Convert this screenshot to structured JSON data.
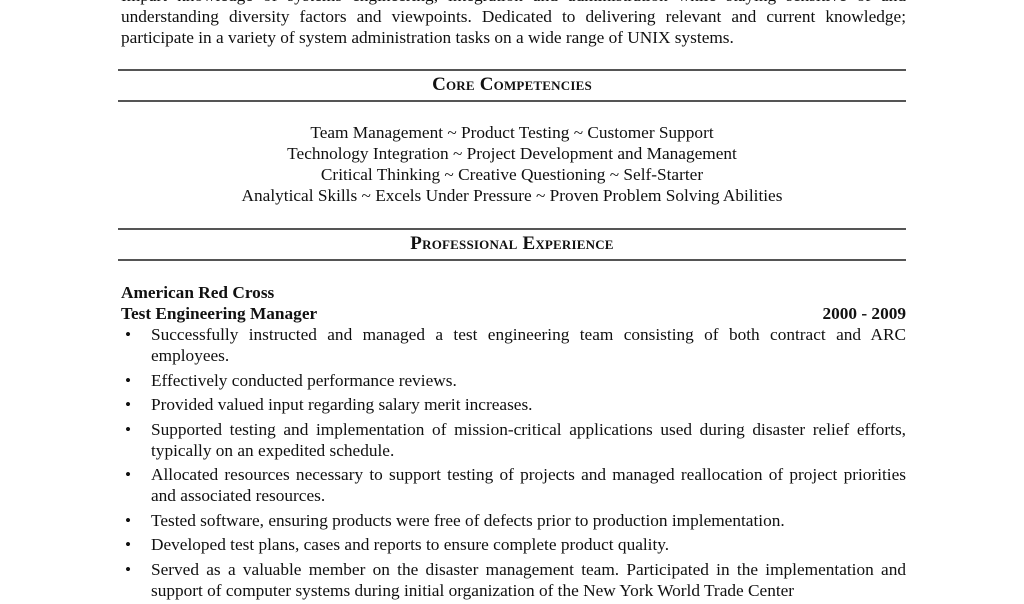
{
  "summary": {
    "lines": [
      "Impart knowledge of systems engineering, integration and administration while staying sensitive of and",
      "understanding diversity factors and viewpoints.  Dedicated to delivering relevant and current knowledge;",
      "participate in a variety of system administration tasks on a wide range of UNIX systems."
    ]
  },
  "sections": {
    "core_competencies": {
      "title": "Core Competencies",
      "rows": [
        "Team Management ~ Product Testing ~ Customer Support",
        "Technology Integration ~ Project Development and Management",
        "Critical Thinking ~ Creative Questioning ~ Self-Starter",
        "Analytical Skills ~ Excels Under Pressure ~ Proven Problem Solving Abilities"
      ]
    },
    "professional_experience": {
      "title": "Professional Experience",
      "jobs": [
        {
          "employer": "American Red Cross",
          "title": "Test Engineering Manager",
          "dates": "2000 - 2009",
          "bullet_glyph": "•",
          "bullets": [
            "Successfully instructed and managed a test engineering team consisting of both contract and ARC employees.",
            "Effectively conducted performance reviews.",
            "Provided valued input regarding salary merit increases.",
            "Supported testing and implementation of mission-critical applications used during disaster relief efforts, typically on an expedited schedule.",
            "Allocated resources necessary to support testing of projects and managed reallocation of project priorities and associated resources.",
            "Tested software, ensuring products were free of defects prior to production implementation.",
            "Developed test plans, cases and reports to ensure complete product quality.",
            "Served as a valuable member on the disaster management team. Participated in the implementation and support of computer systems during initial organization of the New York World Trade Center"
          ]
        }
      ]
    }
  }
}
